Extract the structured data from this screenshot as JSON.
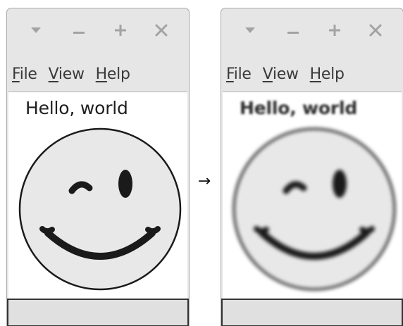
{
  "windows": [
    {
      "titlebar_icons": [
        "dropdown-triangle-icon",
        "minimize-icon",
        "maximize-icon",
        "close-icon"
      ],
      "menu": [
        {
          "mnemonic": "F",
          "rest": "ile"
        },
        {
          "mnemonic": "V",
          "rest": "iew"
        },
        {
          "mnemonic": "H",
          "rest": "elp"
        }
      ],
      "greeting": "Hello, world",
      "rendering": "sharp"
    },
    {
      "titlebar_icons": [
        "dropdown-triangle-icon",
        "minimize-icon",
        "maximize-icon",
        "close-icon"
      ],
      "menu": [
        {
          "mnemonic": "F",
          "rest": "ile"
        },
        {
          "mnemonic": "V",
          "rest": "iew"
        },
        {
          "mnemonic": "H",
          "rest": "elp"
        }
      ],
      "greeting": "Hello, world",
      "rendering": "blurred"
    }
  ],
  "arrow": "→",
  "colors": {
    "window_chrome": "#e6e6e6",
    "canvas": "#ffffff",
    "face_fill": "#e8e8e8",
    "features": "#1a1a1a",
    "titlebar_icons": "#a3a3a3"
  }
}
